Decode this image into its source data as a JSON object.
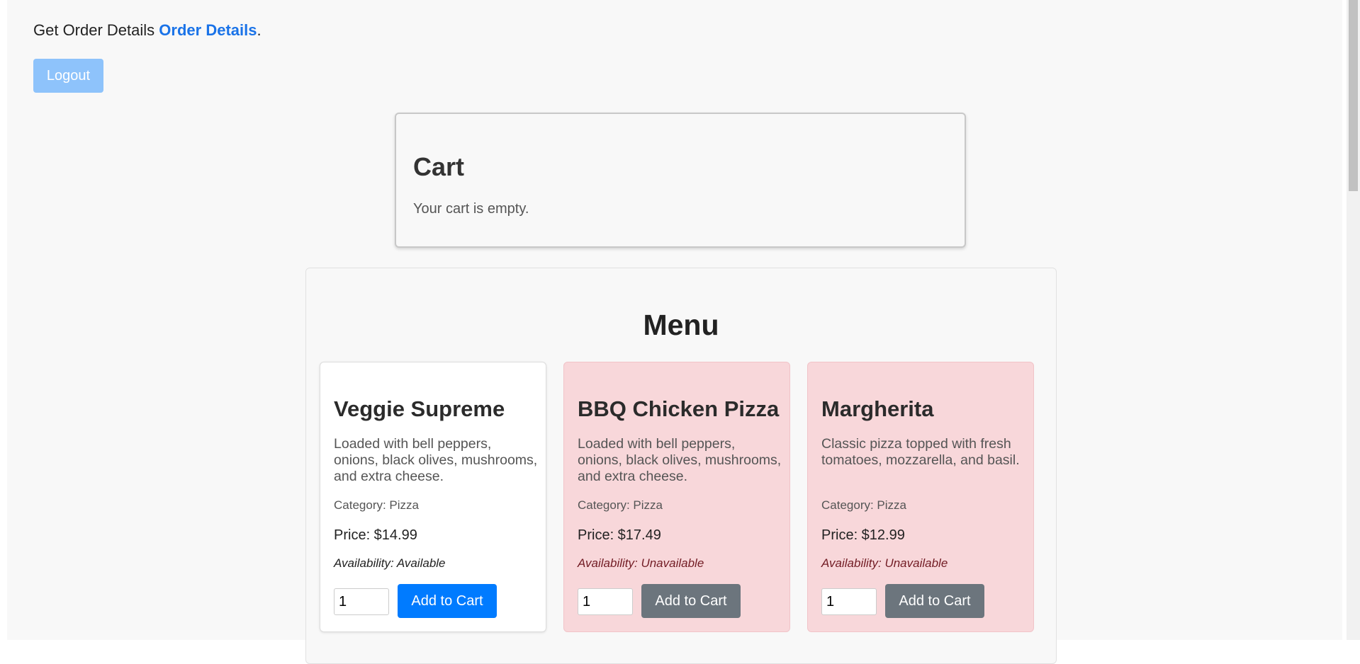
{
  "header": {
    "prefix": "Get Order Details",
    "link_text": "Order Details",
    "suffix": "."
  },
  "logout_label": "Logout",
  "cart": {
    "title": "Cart",
    "empty_message": "Your cart is empty."
  },
  "menu": {
    "title": "Menu",
    "items": [
      {
        "name": "Veggie Supreme",
        "description": "Loaded with bell peppers, onions, black olives, mushrooms, and extra cheese.",
        "category": "Category: Pizza",
        "price": "Price: $14.99",
        "availability": "Availability: Available",
        "quantity": "1",
        "button": "Add to Cart"
      },
      {
        "name": "BBQ Chicken Pizza",
        "description": "Loaded with bell peppers, onions, black olives, mushrooms, and extra cheese.",
        "category": "Category: Pizza",
        "price": "Price: $17.49",
        "availability": "Availability: Unavailable",
        "quantity": "1",
        "button": "Add to Cart"
      },
      {
        "name": "Margherita",
        "description": "Classic pizza topped with fresh tomatoes, mozzarella, and basil.",
        "category": "Category: Pizza",
        "price": "Price: $12.99",
        "availability": "Availability: Unavailable",
        "quantity": "1",
        "button": "Add to Cart"
      }
    ]
  },
  "colors": {
    "link": "#1a73e8",
    "primary_button": "#007bff",
    "disabled_button": "#6c757d",
    "unavailable_card": "#f8d7da",
    "logout_button": "#8ec3fb"
  }
}
